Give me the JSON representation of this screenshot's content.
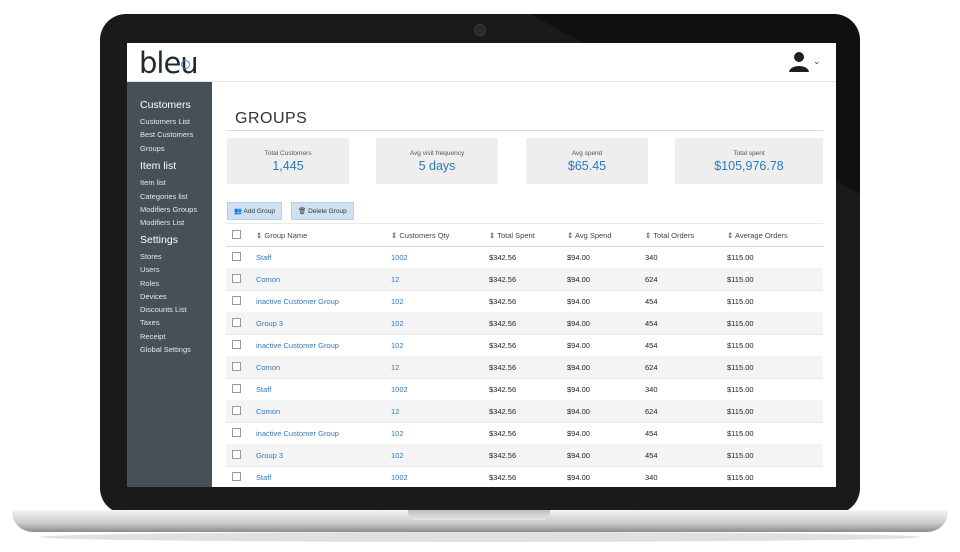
{
  "app": {
    "logo": "bleu"
  },
  "sidebar": {
    "sections": [
      {
        "title": "Customers",
        "items": [
          "Customers List",
          "Best Customers",
          "Groups"
        ]
      },
      {
        "title": "Item list",
        "items": [
          "Item list",
          "Categories list",
          "Modifiers Groups",
          "Modifiers List"
        ]
      },
      {
        "title": "Settings",
        "items": [
          "Stores",
          "Users",
          "Roles",
          "Devices",
          "Discounts List",
          "Taxes",
          "Receipt",
          "Global Settings"
        ]
      }
    ]
  },
  "page": {
    "title": "GROUPS"
  },
  "stats": [
    {
      "label": "Total Customers",
      "value": "1,445"
    },
    {
      "label": "Avg visit frequency",
      "value": "5 days"
    },
    {
      "label": "Avg spend",
      "value": "$65.45"
    },
    {
      "label": "Total spent",
      "value": "$105,976.78"
    }
  ],
  "toolbar": {
    "add_label": "Add Group",
    "delete_label": "Delete Group"
  },
  "table": {
    "columns": [
      "Group Name",
      "Customers Qty",
      "Total Spent",
      "Avg Spend",
      "Total Orders",
      "Average Orders"
    ],
    "rows": [
      [
        "Staff",
        "1002",
        "$342.56",
        "$94.00",
        "340",
        "$115.00"
      ],
      [
        "Comon",
        "12",
        "$342.56",
        "$94.00",
        "624",
        "$115.00"
      ],
      [
        "inactive Customer Group",
        "102",
        "$342.56",
        "$94.00",
        "454",
        "$115.00"
      ],
      [
        "Group 3",
        "102",
        "$342.56",
        "$94.00",
        "454",
        "$115.00"
      ],
      [
        "inactive Customer Group",
        "102",
        "$342.56",
        "$94.00",
        "454",
        "$115.00"
      ],
      [
        "Comon",
        "12",
        "$342.56",
        "$94.00",
        "624",
        "$115.00"
      ],
      [
        "Staff",
        "1002",
        "$342.56",
        "$94.00",
        "340",
        "$115.00"
      ],
      [
        "Comon",
        "12",
        "$342.56",
        "$94.00",
        "624",
        "$115.00"
      ],
      [
        "inactive Customer Group",
        "102",
        "$342.56",
        "$94.00",
        "454",
        "$115.00"
      ],
      [
        "Group 3",
        "102",
        "$342.56",
        "$94.00",
        "454",
        "$115.00"
      ],
      [
        "Staff",
        "1002",
        "$342.56",
        "$94.00",
        "340",
        "$115.00"
      ]
    ]
  },
  "colors": {
    "sidebar": "#474f57",
    "accent": "#2f79b8",
    "link": "#3776b8",
    "button": "#cfe0f3"
  },
  "icons": {
    "user": "user-icon",
    "chevron": "chevron-down-icon",
    "add": "users-icon",
    "delete": "trash-icon",
    "sort": "sort-icon"
  }
}
